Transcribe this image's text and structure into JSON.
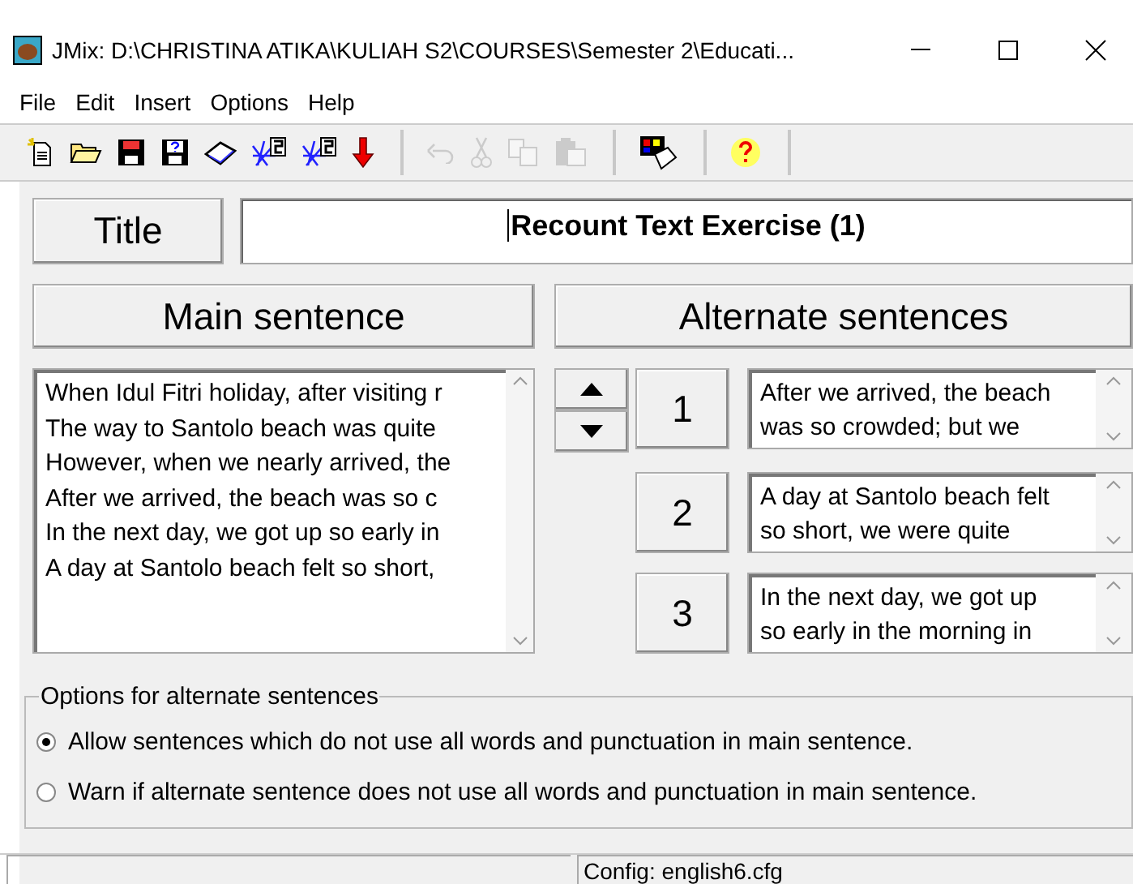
{
  "window": {
    "title": "JMix: D:\\CHRISTINA ATIKA\\KULIAH S2\\COURSES\\Semester 2\\Educati..."
  },
  "menu": [
    "File",
    "Edit",
    "Insert",
    "Options",
    "Help"
  ],
  "toolbar": [
    [
      {
        "kind": "new",
        "disabled": false
      },
      {
        "kind": "open",
        "disabled": false
      },
      {
        "kind": "save",
        "disabled": false
      },
      {
        "kind": "saveas",
        "disabled": false
      },
      {
        "kind": "book",
        "disabled": false
      },
      {
        "kind": "web",
        "disabled": false
      },
      {
        "kind": "web2",
        "disabled": false
      },
      {
        "kind": "arrow",
        "disabled": false
      }
    ],
    [
      {
        "kind": "undo",
        "disabled": true
      },
      {
        "kind": "cut",
        "disabled": true
      },
      {
        "kind": "copy",
        "disabled": true
      },
      {
        "kind": "paste",
        "disabled": true
      }
    ],
    [
      {
        "kind": "palette",
        "disabled": false
      }
    ],
    [
      {
        "kind": "help",
        "disabled": false
      }
    ]
  ],
  "title_label": "Title",
  "title_value": "Recount Text Exercise (1)",
  "main_header": "Main sentence",
  "alternate_header": "Alternate sentences",
  "main_lines": [
    "When Idul Fitri holiday, after visiting r",
    "The way to Santolo beach was quite",
    "However, when we nearly arrived, the",
    "After we arrived, the beach was so c",
    "In the next day, we got up so early in",
    "A day at Santolo beach felt so short,"
  ],
  "alternates": [
    {
      "number": "1",
      "lines": [
        "After we arrived, the beach",
        "was so crowded; but we"
      ]
    },
    {
      "number": "2",
      "lines": [
        "A day at Santolo beach felt",
        "so short, we were quite"
      ]
    },
    {
      "number": "3",
      "lines": [
        "In the next day, we got up",
        "so early in the morning in"
      ]
    }
  ],
  "options": {
    "legend": "Options for alternate sentences",
    "radios": [
      {
        "label": "Allow sentences which do not use all words and punctuation in main sentence.",
        "selected": true
      },
      {
        "label": "Warn if alternate sentence does not use all words and punctuation in main sentence.",
        "selected": false
      }
    ]
  },
  "status_bar": {
    "config": "Config: english6.cfg"
  }
}
